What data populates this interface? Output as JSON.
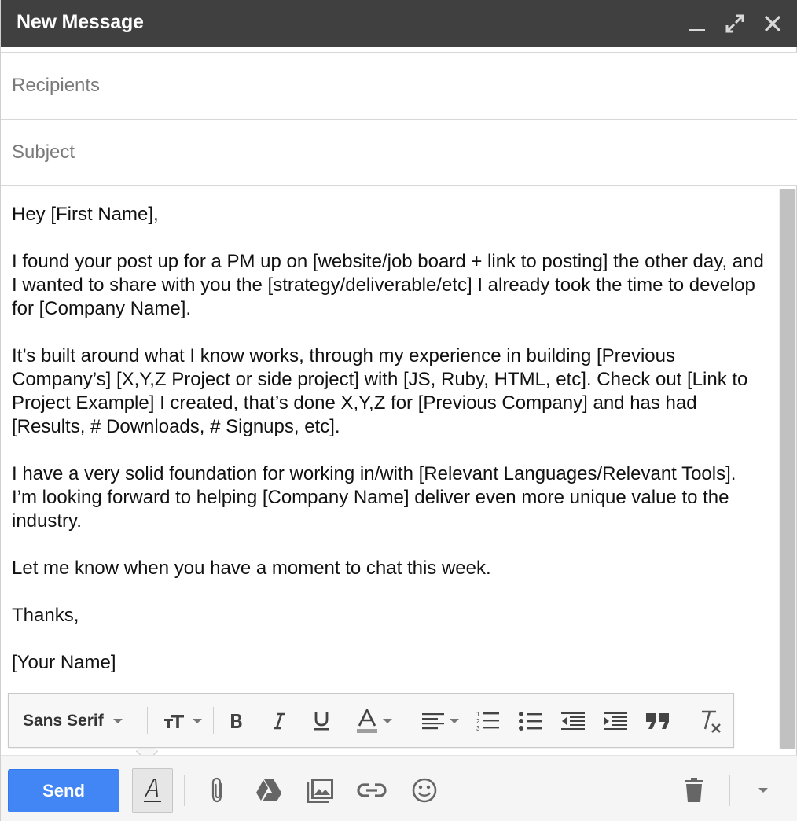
{
  "window": {
    "title": "New Message",
    "controls": [
      "minimize-icon",
      "expand-icon",
      "close-icon"
    ]
  },
  "recipients": {
    "placeholder": "Recipients",
    "value": ""
  },
  "subject": {
    "placeholder": "Subject",
    "value": ""
  },
  "body": {
    "paragraphs": [
      "Hey [First Name],",
      "I found your post up for a PM up on [website/job board + link to posting] the other day, and I wanted to share with you the [strategy/deliverable/etc] I already took the time to develop for [Company Name].",
      "It’s built around what I know works, through my experience in building [Previous Company’s] [X,Y,Z Project or side project] with [JS, Ruby, HTML, etc]. Check out [Link to Project Example] I created, that’s done X,Y,Z for [Previous Company] and has had [Results, # Downloads, # Signups, etc].",
      "I have a very solid foundation for working in/with [Relevant Languages/Relevant Tools]. I’m looking forward to helping [Company Name] deliver even more unique value to the industry.",
      "Let me know when you have a moment to chat this week.",
      "Thanks,",
      "[Your Name]"
    ]
  },
  "format_toolbar": {
    "font": "Sans Serif",
    "icons": [
      "text-size-icon",
      "bold-icon",
      "italic-icon",
      "underline-icon",
      "text-color-icon",
      "align-icon",
      "numbered-list-icon",
      "bulleted-list-icon",
      "indent-less-icon",
      "indent-more-icon",
      "quote-icon",
      "remove-formatting-icon"
    ],
    "colors": {
      "text_color_swatch": "#9e9e9e"
    }
  },
  "bottom_bar": {
    "send_label": "Send",
    "icons": [
      "formatting-options-icon",
      "attach-icon",
      "drive-icon",
      "insert-photo-icon",
      "insert-link-icon",
      "emoji-icon",
      "trash-icon",
      "more-options-icon"
    ]
  },
  "colors": {
    "titlebar": "#404040",
    "send_button": "#4285f4",
    "icon": "#555555"
  }
}
